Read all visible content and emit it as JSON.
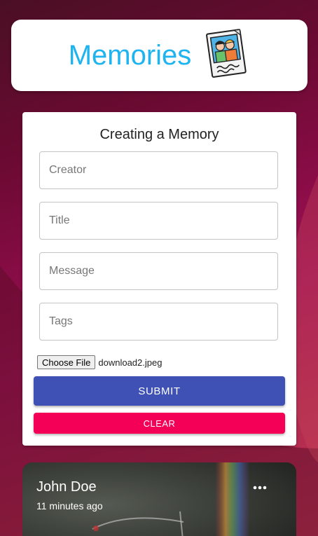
{
  "header": {
    "title": "Memories",
    "logo_icon": "photo-memories-icon"
  },
  "form": {
    "title": "Creating a Memory",
    "fields": {
      "creator_placeholder": "Creator",
      "title_placeholder": "Title",
      "message_placeholder": "Message",
      "tags_placeholder": "Tags"
    },
    "file": {
      "button_label": "Choose File",
      "file_name": "download2.jpeg"
    },
    "submit_label": "SUBMIT",
    "clear_label": "CLEAR"
  },
  "memories": [
    {
      "author": "John Doe",
      "time": "11 minutes ago",
      "menu_icon": "more-horizontal-icon"
    }
  ],
  "colors": {
    "title_blue": "#1db4f0",
    "submit_primary": "#3f51b5",
    "clear_secondary": "#f50057",
    "background": "#8a0c47"
  }
}
